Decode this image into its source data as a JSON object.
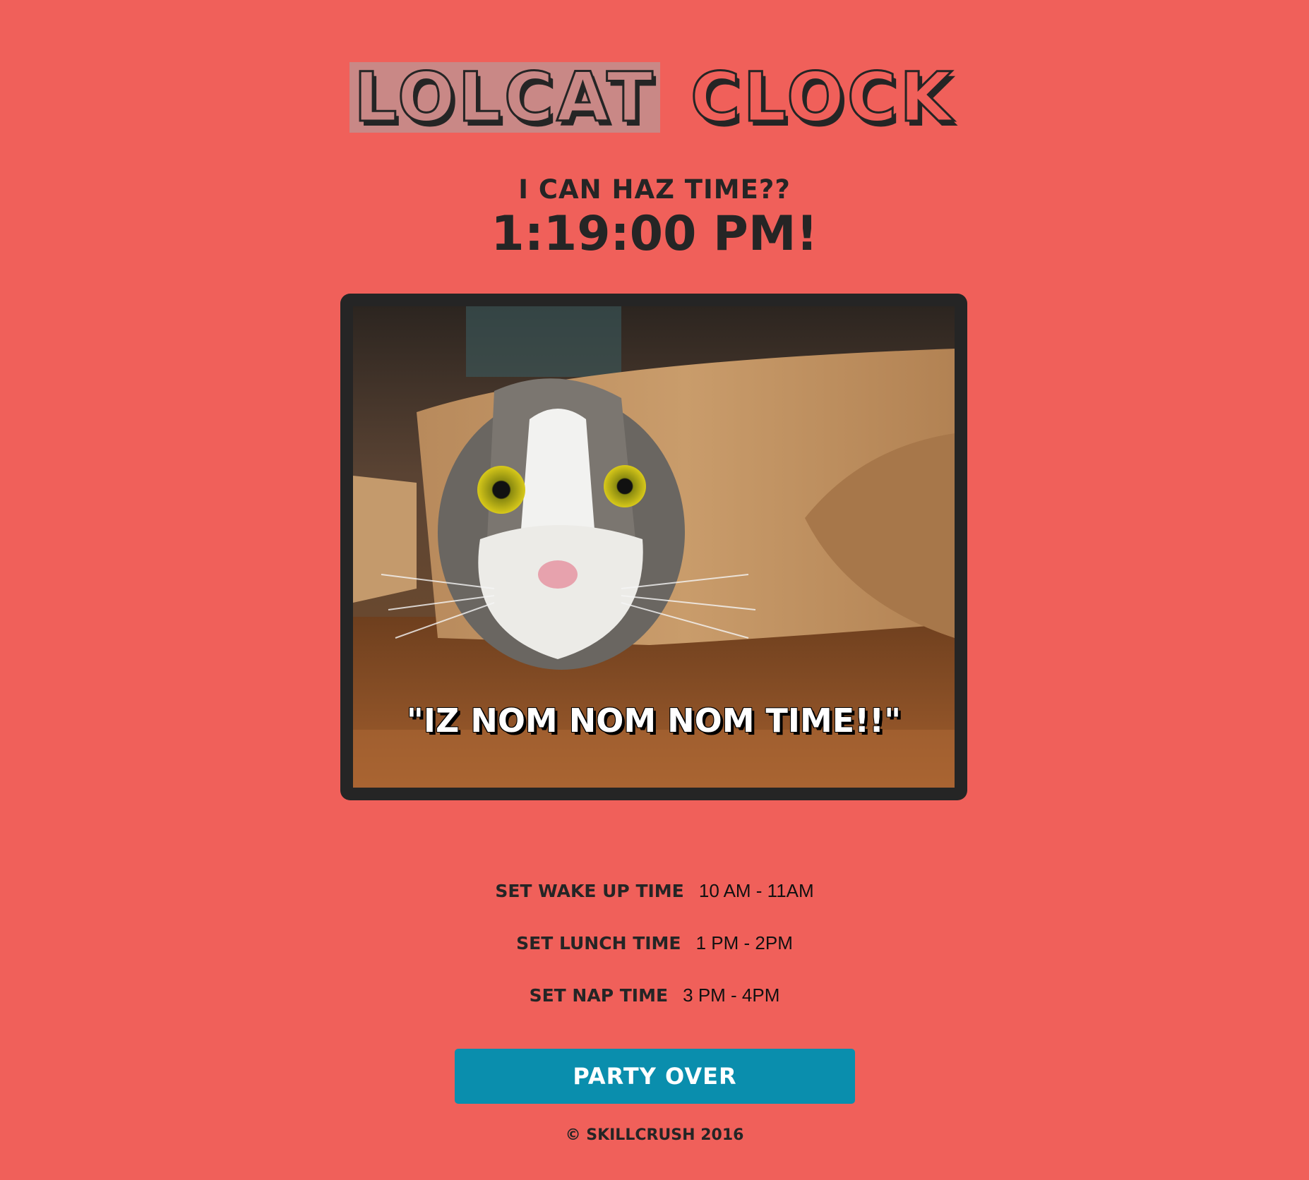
{
  "header": {
    "title_word_1": "Lolcat",
    "title_word_2": "Clock",
    "subtitle": "I can haz time??",
    "clock_time": "1:19:00 PM!"
  },
  "image": {
    "caption": "\"IZ NOM NOM NOM TIME!!\""
  },
  "schedule": [
    {
      "label": "Set Wake Up Time",
      "value": "10 AM - 11AM"
    },
    {
      "label": "Set Lunch Time",
      "value": "1 PM - 2PM"
    },
    {
      "label": "Set Nap Time",
      "value": "3 PM - 4PM"
    }
  ],
  "party_button_label": "Party Over",
  "footer": "© Skillcrush 2016",
  "colors": {
    "background": "#f0605a",
    "text_dark": "#252525",
    "button": "#0a8ead",
    "title_highlight": "#c98886"
  }
}
